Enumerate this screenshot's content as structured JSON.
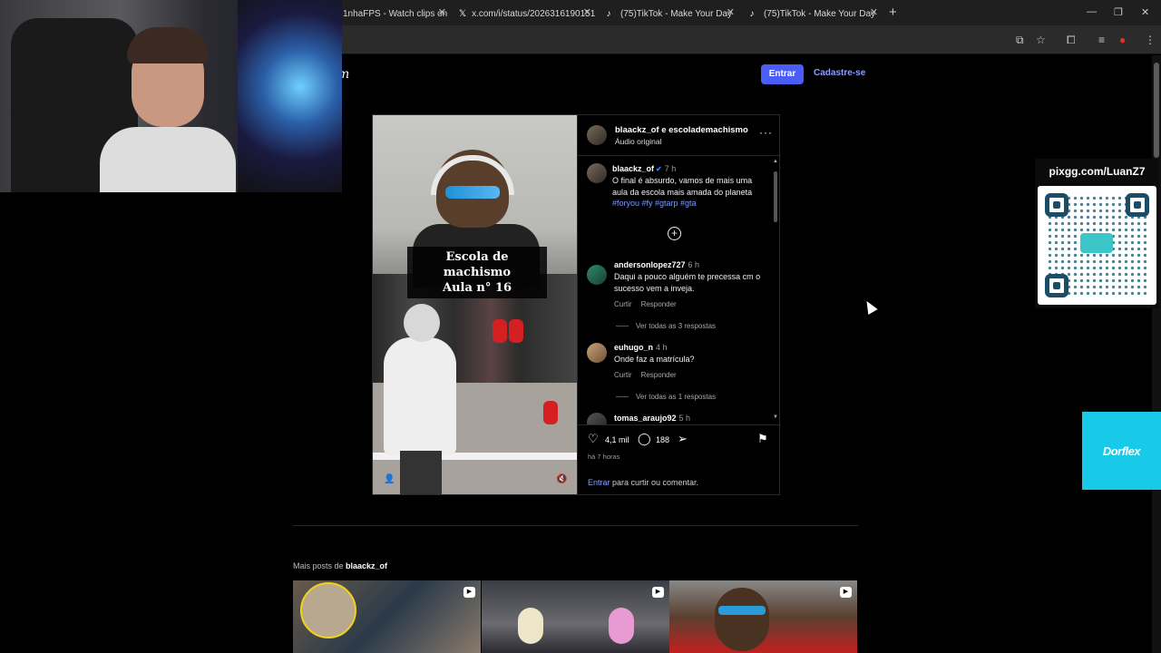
{
  "browser": {
    "tabs": [
      {
        "title": "1nhaFPS - Watch clips on K",
        "icon": "kick-icon"
      },
      {
        "title": "x.com/i/status/2026316190151",
        "icon": "x-icon"
      },
      {
        "title": "(75)TikTok - Make Your Day",
        "icon": "tiktok-icon"
      },
      {
        "title": "(75)TikTok - Make Your Day",
        "icon": "tiktok-icon"
      }
    ],
    "new_tab": "+",
    "close_glyph": "✕",
    "window_controls": {
      "minimize": "—",
      "restore": "❐",
      "close": "✕"
    },
    "toolbar_icons": [
      "cast-icon",
      "star-icon",
      "extensions-icon",
      "media-icon",
      "profile-icon",
      "menu-icon"
    ]
  },
  "site": {
    "brand_partial": "m",
    "login_button": "Entrar",
    "signup_link": "Cadastre-se"
  },
  "post": {
    "header": {
      "authors": "blaackz_of e escolademachismo",
      "audio": "Áudio original",
      "more": "···"
    },
    "video_caption_line1": "Escola de machismo",
    "video_caption_line2": "Aula n° 16",
    "caption": {
      "user": "blaackz_of",
      "verified": "✔",
      "time": "7 h",
      "text": "O final é absurdo, vamos de mais uma aula da escola mais amada do planeta",
      "tags": "#foryou #fy #gtarp #gta"
    },
    "load_more": "+",
    "comments": [
      {
        "user": "andersonlopez727",
        "time": "6 h",
        "text": "Daqui a pouco alguém te precessa cm o sucesso vem a inveja.",
        "like": "Curtir",
        "reply": "Responder",
        "view_replies": "Ver todas as 3 respostas"
      },
      {
        "user": "euhugo_n",
        "time": "4 h",
        "text": "Onde faz a matrícula?",
        "like": "Curtir",
        "reply": "Responder",
        "view_replies": "Ver todas as 1 respostas"
      },
      {
        "user": "tomas_araujo92",
        "time": "5 h"
      }
    ],
    "likes": "4,1 mil",
    "comment_count": "188",
    "posted_ago": "há 7 horas",
    "login_prompt_link": "Entrar",
    "login_prompt_rest": " para curtir ou comentar."
  },
  "more_posts": {
    "prefix": "Mais posts de ",
    "user": "blaackz_of",
    "thumbnails": [
      {
        "icon": "reel-icon"
      },
      {
        "icon": "reel-icon"
      },
      {
        "icon": "reel-icon"
      }
    ]
  },
  "overlays": {
    "qr_label": "pixgg.com/LuanZ7",
    "sponsor": "Dorflex"
  },
  "colors": {
    "accent": "#4a5df9",
    "link": "#8d9dff",
    "hashtag": "#7b9cff",
    "sponsor_bg": "#18c9e8"
  }
}
